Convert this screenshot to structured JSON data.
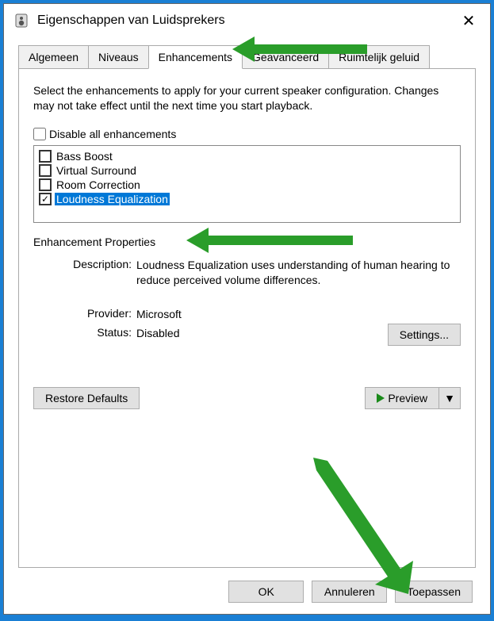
{
  "titlebar": {
    "text": "Eigenschappen van Luidsprekers"
  },
  "tabs": {
    "items": [
      {
        "label": "Algemeen"
      },
      {
        "label": "Niveaus"
      },
      {
        "label": "Enhancements",
        "active": true
      },
      {
        "label": "Geavanceerd"
      },
      {
        "label": "Ruimtelijk geluid"
      }
    ]
  },
  "panel": {
    "description": "Select the enhancements to apply for your current speaker configuration. Changes may not take effect until the next time you start playback.",
    "disable_all_label": "Disable all enhancements",
    "enhancements": [
      {
        "label": "Bass Boost",
        "checked": false,
        "selected": false
      },
      {
        "label": "Virtual Surround",
        "checked": false,
        "selected": false
      },
      {
        "label": "Room Correction",
        "checked": false,
        "selected": false
      },
      {
        "label": "Loudness Equalization",
        "checked": true,
        "selected": true
      }
    ],
    "properties_title": "Enhancement Properties",
    "desc_label": "Description:",
    "desc_value": "Loudness Equalization uses understanding of human hearing to reduce perceived volume differences.",
    "provider_label": "Provider:",
    "provider_value": "Microsoft",
    "status_label": "Status:",
    "status_value": "Disabled",
    "settings_btn": "Settings...",
    "restore_btn": "Restore Defaults",
    "preview_btn": "Preview"
  },
  "buttons": {
    "ok": "OK",
    "cancel": "Annuleren",
    "apply": "Toepassen"
  }
}
